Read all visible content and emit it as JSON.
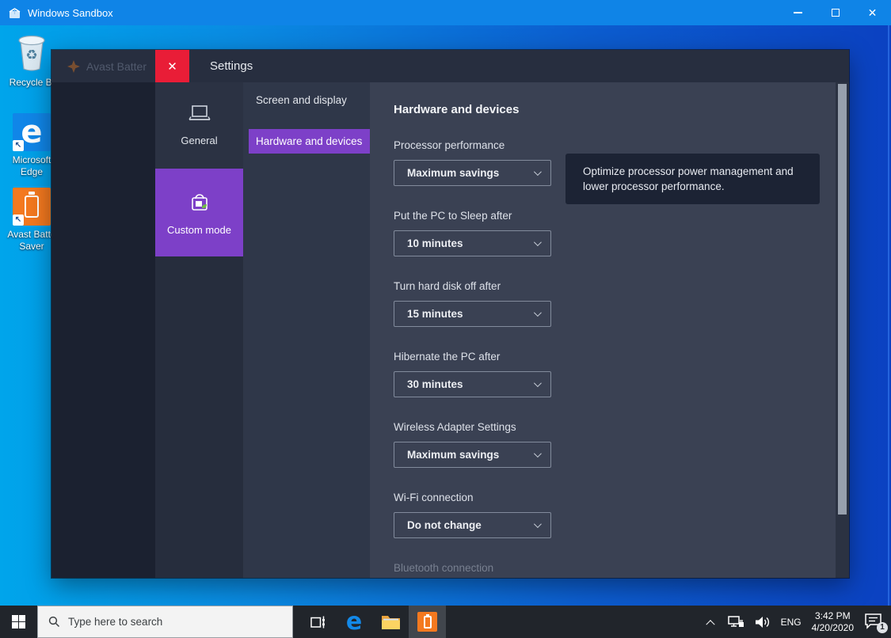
{
  "titlebar": {
    "title": "Windows Sandbox"
  },
  "desktop_icons": [
    {
      "label": "Recycle Bi"
    },
    {
      "label": "Microsoft Edge"
    },
    {
      "label": "Avast Batte Saver"
    }
  ],
  "app": {
    "ghost_title": "Avast Batter",
    "settings_title": "Settings",
    "sidebar": {
      "general_label": "General",
      "custom_label": "Custom mode"
    },
    "nav": {
      "screen_label": "Screen and display",
      "hardware_label": "Hardware and devices"
    },
    "content": {
      "heading": "Hardware and devices",
      "tooltip": "Optimize processor power management and lower processor performance.",
      "fields": [
        {
          "label": "Processor performance",
          "value": "Maximum savings"
        },
        {
          "label": "Put the PC to Sleep after",
          "value": "10 minutes"
        },
        {
          "label": "Turn hard disk off after",
          "value": "15 minutes"
        },
        {
          "label": "Hibernate the PC after",
          "value": "30 minutes"
        },
        {
          "label": "Wireless Adapter Settings",
          "value": "Maximum savings"
        },
        {
          "label": "Wi-Fi connection",
          "value": "Do not change"
        }
      ],
      "partial_field_label": "Bluetooth connection"
    }
  },
  "taskbar": {
    "search_placeholder": "Type here to search",
    "tray": {
      "language": "ENG",
      "time": "3:42 PM",
      "date": "4/20/2020",
      "notification_count": "1"
    }
  },
  "colors": {
    "titlebar_blue": "#0f84e7",
    "accent_purple": "#7d40c8",
    "avast_red": "#e91d37",
    "avast_orange": "#f4791f",
    "main_bg": "#3a4153",
    "tooltip_bg": "#1c2334"
  }
}
